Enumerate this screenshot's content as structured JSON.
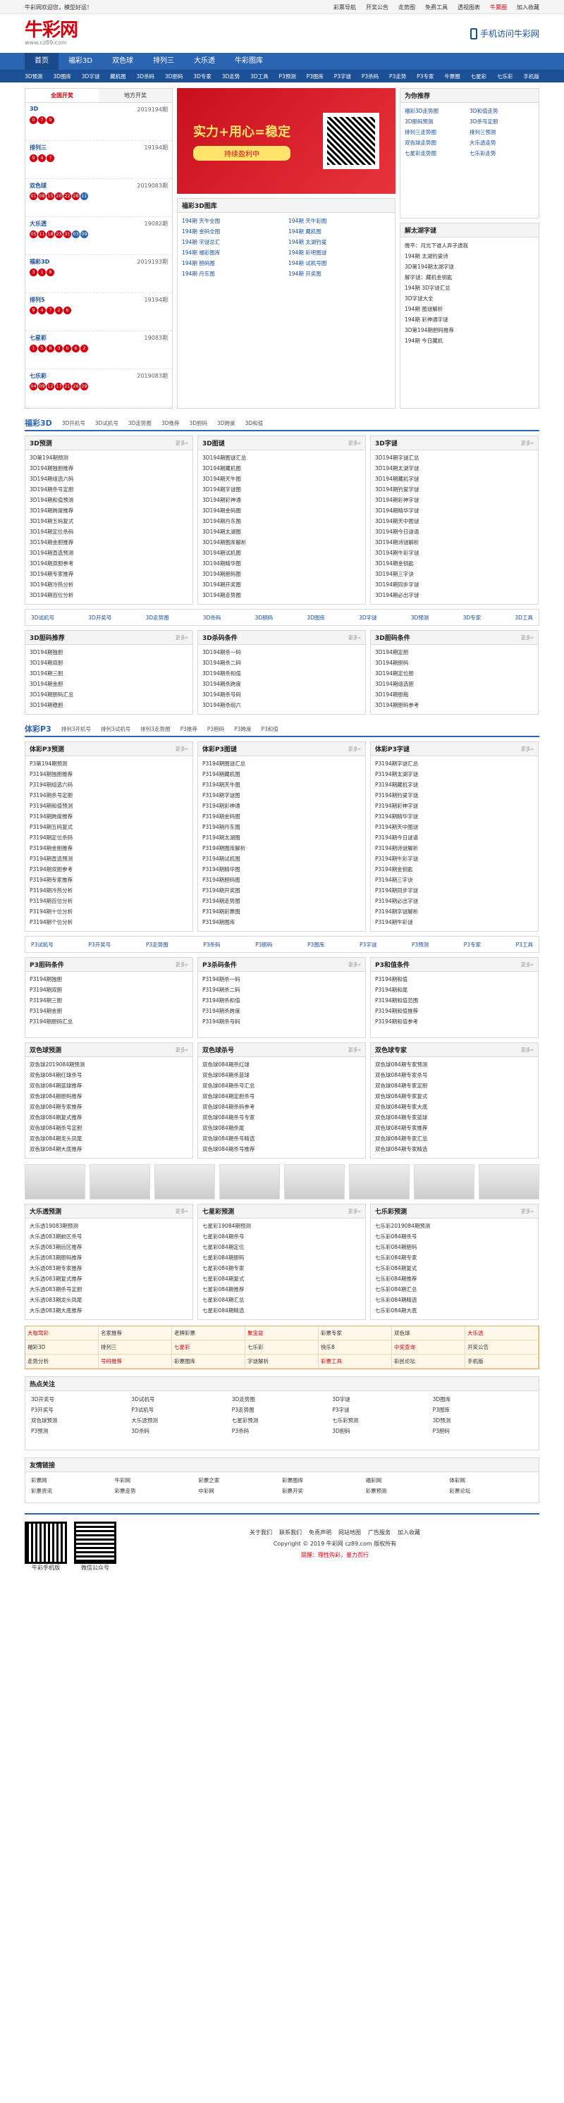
{
  "topbar": {
    "left": "牛彩网欢迎您，模型好运！",
    "links": [
      "彩票导航",
      "开奖公告",
      "走势图",
      "免费工具",
      "透视图表",
      "牛票圈",
      "加入收藏"
    ]
  },
  "header": {
    "logo": "牛彩网",
    "site": "www.cz89.com",
    "mobile": "手机访问牛彩网"
  },
  "nav": [
    "首页",
    "福彩3D",
    "双色球",
    "排列三",
    "大乐透",
    "牛彩图库"
  ],
  "subnav": [
    "3D预测",
    "3D图库",
    "3D字谜",
    "藏机图",
    "3D杀码",
    "3D胆码",
    "3D专家",
    "3D走势",
    "3D工具",
    "P3预测",
    "P3图库",
    "P3字谜",
    "P3杀码",
    "P3走势",
    "P3专家",
    "牛票圈",
    "七星彩",
    "七乐彩",
    "手机版"
  ],
  "kaijiang": {
    "tabs": [
      "全国开奖",
      "地方开奖"
    ],
    "items": [
      {
        "name": "3D",
        "issue": "2019194期",
        "nums": [
          "0",
          "7",
          "9"
        ]
      },
      {
        "name": "排列三",
        "issue": "19194期",
        "nums": [
          "9",
          "4",
          "7"
        ]
      },
      {
        "name": "双色球",
        "issue": "2019083期",
        "nums": [
          "01",
          "08",
          "15",
          "20",
          "22",
          "28",
          "11"
        ]
      },
      {
        "name": "大乐透",
        "issue": "19082期",
        "nums": [
          "05",
          "11",
          "18",
          "23",
          "31",
          "03",
          "09"
        ]
      },
      {
        "name": "福彩3D",
        "issue": "2019193期",
        "nums": [
          "3",
          "1",
          "8"
        ]
      },
      {
        "name": "排列5",
        "issue": "19194期",
        "nums": [
          "9",
          "4",
          "7",
          "2",
          "6"
        ]
      },
      {
        "name": "七星彩",
        "issue": "19083期",
        "nums": [
          "1",
          "5",
          "8",
          "3",
          "0",
          "6",
          "2"
        ]
      },
      {
        "name": "七乐彩",
        "issue": "2019083期",
        "nums": [
          "04",
          "09",
          "12",
          "17",
          "21",
          "26",
          "29"
        ]
      }
    ]
  },
  "banner": {
    "line1": "实力+用心=稳定",
    "line2": "持续盈利中"
  },
  "rank": {
    "title": "为你推荐",
    "items": [
      "福彩3D走势图",
      "3D和值走势",
      "3D胆码预测",
      "3D杀号定胆",
      "排列三走势图",
      "排列三预测",
      "双色球走势图",
      "大乐透走势",
      "七星彩走势图",
      "七乐彩走势"
    ]
  },
  "tuku": {
    "title": "福彩3D图库",
    "items": [
      "194期 天牛全图",
      "194期 天牛彩图",
      "194期 金码全图",
      "194期 藏机图",
      "194期 字谜总汇",
      "194期 太湖钓叟",
      "194期 福彩图库",
      "194期 彩吧图谜",
      "194期 胆码图",
      "194期 试机号图",
      "194期 丹东图",
      "194期 开奖图"
    ]
  },
  "zimi": {
    "title": "解太湖字谜",
    "items": [
      "晚平：月光下谁人弃子遗我",
      "194期 太湖钓叟诗",
      "3D第194期太湖字谜",
      "解字谜：藏机金钥匙",
      "194期 3D字谜汇总",
      "3D字谜大全",
      "194期 图谜解析",
      "194期 彩神通字谜",
      "3D第194期胆码推荐",
      "194期 今日藏机"
    ]
  },
  "sec1": {
    "title": "福彩3D",
    "tabs": [
      "3D开机号",
      "3D试机号",
      "3D走势图",
      "3D推荐",
      "3D胆码",
      "3D跨度",
      "3D和值"
    ],
    "cols": [
      {
        "title": "3D预测",
        "items": [
          "3D第194期预测",
          "3D194期独胆推荐",
          "3D194期组选六码",
          "3D194期杀号定胆",
          "3D194期和值预测",
          "3D194期跨度推荐",
          "3D194期五码复式",
          "3D194期定位杀码",
          "3D194期金胆推荐",
          "3D194期直选预测",
          "3D194期双胆参考",
          "3D194期专家推荐",
          "3D194期冷热分析",
          "3D194期百位分析"
        ]
      },
      {
        "title": "3D图谜",
        "items": [
          "3D194期图谜汇总",
          "3D194期藏机图",
          "3D194期天牛图",
          "3D194期字谜图",
          "3D194期彩神通",
          "3D194期金码图",
          "3D194期丹东图",
          "3D194期太湖图",
          "3D194期图库解析",
          "3D194期试机图",
          "3D194期精华图",
          "3D194期胆码图",
          "3D194期开奖图",
          "3D194期走势图"
        ]
      },
      {
        "title": "3D字谜",
        "items": [
          "3D194期字谜汇总",
          "3D194期太湖字谜",
          "3D194期藏机字谜",
          "3D194期钓叟字谜",
          "3D194期彩神字谜",
          "3D194期精华字谜",
          "3D194期天中图谜",
          "3D194期今日谜语",
          "3D194期诗谜解析",
          "3D194期牛彩字谜",
          "3D194期金钥匙",
          "3D194期三字诀",
          "3D194期同步字谜",
          "3D194期必出字谜"
        ]
      }
    ]
  },
  "kw1": [
    "3D试机号",
    "3D开奖号",
    "3D走势图",
    "3D杀码",
    "3D胆码",
    "3D图库",
    "3D字谜",
    "3D预测",
    "3D专家",
    "3D工具"
  ],
  "sec1b": [
    {
      "title": "3D胆码推荐",
      "items": [
        "3D194期独胆",
        "3D194期双胆",
        "3D194期三胆",
        "3D194期金胆",
        "3D194期胆码汇总",
        "3D194期稳胆"
      ]
    },
    {
      "title": "3D杀码条件",
      "items": [
        "3D194期杀一码",
        "3D194期杀二码",
        "3D194期杀和值",
        "3D194期杀跨度",
        "3D194期杀号码",
        "3D194期杀组六"
      ]
    },
    {
      "title": "3D胆码条件",
      "items": [
        "3D194期定胆",
        "3D194期胆码",
        "3D194期定位胆",
        "3D194期组选胆",
        "3D194期胆拖",
        "3D194期胆码参考"
      ]
    }
  ],
  "sec2": {
    "title": "体彩P3",
    "tabs": [
      "排列3开机号",
      "排列3试机号",
      "排列3走势图",
      "P3推荐",
      "P3胆码",
      "P3跨度",
      "P3和值"
    ],
    "cols": [
      {
        "title": "体彩P3预测",
        "items": [
          "P3第194期预测",
          "P3194期独胆推荐",
          "P3194期组选六码",
          "P3194期杀号定胆",
          "P3194期和值预测",
          "P3194期跨度推荐",
          "P3194期五码复式",
          "P3194期定位杀码",
          "P3194期金胆推荐",
          "P3194期直选预测",
          "P3194期双胆参考",
          "P3194期专家推荐",
          "P3194期冷热分析",
          "P3194期百位分析",
          "P3194期十位分析",
          "P3194期个位分析"
        ]
      },
      {
        "title": "体彩P3图谜",
        "items": [
          "P3194期图谜汇总",
          "P3194期藏机图",
          "P3194期天牛图",
          "P3194期字谜图",
          "P3194期彩神通",
          "P3194期金码图",
          "P3194期丹东图",
          "P3194期太湖图",
          "P3194期图库解析",
          "P3194期试机图",
          "P3194期精华图",
          "P3194期胆码图",
          "P3194期开奖图",
          "P3194期走势图",
          "P3194期彩票图",
          "P3194期图库"
        ]
      },
      {
        "title": "体彩P3字谜",
        "items": [
          "P3194期字谜汇总",
          "P3194期太湖字谜",
          "P3194期藏机字谜",
          "P3194期钓叟字谜",
          "P3194期彩神字谜",
          "P3194期精华字谜",
          "P3194期天中图谜",
          "P3194期今日谜语",
          "P3194期诗谜解析",
          "P3194期牛彩字谜",
          "P3194期金钥匙",
          "P3194期三字诀",
          "P3194期同步字谜",
          "P3194期必出字谜",
          "P3194期字谜解析",
          "P3194期牛彩谜"
        ]
      }
    ]
  },
  "kw2": [
    "P3试机号",
    "P3开奖号",
    "P3走势图",
    "P3杀码",
    "P3胆码",
    "P3图库",
    "P3字谜",
    "P3预测",
    "P3专家",
    "P3工具"
  ],
  "sec2b": [
    {
      "title": "P3胆码条件",
      "items": [
        "P3194期独胆",
        "P3194期双胆",
        "P3194期三胆",
        "P3194期金胆",
        "P3194期胆码汇总"
      ]
    },
    {
      "title": "P3杀码条件",
      "items": [
        "P3194期杀一码",
        "P3194期杀二码",
        "P3194期杀和值",
        "P3194期杀跨度",
        "P3194期杀号码"
      ]
    },
    {
      "title": "P3和值条件",
      "items": [
        "P3194期和值",
        "P3194期和尾",
        "P3194期和值范围",
        "P3194期和值推荐",
        "P3194期和值参考"
      ]
    }
  ],
  "sec3": [
    {
      "title": "双色球预测",
      "items": [
        "双色球2019084期预测",
        "双色球084期红球杀号",
        "双色球084期蓝球推荐",
        "双色球084期胆码推荐",
        "双色球084期专家推荐",
        "双色球084期复式推荐",
        "双色球084期杀号定胆",
        "双色球084期龙头凤尾",
        "双色球084期大底推荐"
      ]
    },
    {
      "title": "双色球杀号",
      "items": [
        "双色球084期杀红球",
        "双色球084期杀蓝球",
        "双色球084期杀号汇总",
        "双色球084期定胆杀号",
        "双色球084期杀码参考",
        "双色球084期杀号专家",
        "双色球084期杀尾",
        "双色球084期杀号精选",
        "双色球084期杀号推荐"
      ]
    },
    {
      "title": "双色球专家",
      "items": [
        "双色球084期专家预测",
        "双色球084期专家杀号",
        "双色球084期专家定胆",
        "双色球084期专家复式",
        "双色球084期专家大底",
        "双色球084期专家蓝球",
        "双色球084期专家推荐",
        "双色球084期专家汇总",
        "双色球084期专家精选"
      ]
    }
  ],
  "sec4": [
    {
      "title": "大乐透预测",
      "items": [
        "大乐透19083期预测",
        "大乐透083期前区杀号",
        "大乐透083期后区推荐",
        "大乐透083期胆码推荐",
        "大乐透083期专家推荐",
        "大乐透083期复式推荐",
        "大乐透083期杀号定胆",
        "大乐透083期龙头凤尾",
        "大乐透083期大底推荐"
      ]
    },
    {
      "title": "七星彩预测",
      "items": [
        "七星彩19084期预测",
        "七星彩084期杀号",
        "七星彩084期定位",
        "七星彩084期胆码",
        "七星彩084期专家",
        "七星彩084期复式",
        "七星彩084期推荐",
        "七星彩084期汇总",
        "七星彩084期精选"
      ]
    },
    {
      "title": "七乐彩预测",
      "items": [
        "七乐彩2019084期预测",
        "七乐彩084期杀号",
        "七乐彩084期胆码",
        "七乐彩084期专家",
        "七乐彩084期复式",
        "七乐彩084期推荐",
        "七乐彩084期汇总",
        "七乐彩084期精选",
        "七乐彩084期大底"
      ]
    }
  ],
  "ads": [
    "大咖驾彩",
    "名家推荐",
    "老牌彩票",
    "聚宝盆",
    "彩票专家",
    "双色球",
    "大乐透",
    "福彩3D",
    "排列三",
    "七星彩",
    "七乐彩",
    "快乐8",
    "中奖查询",
    "开奖公告",
    "走势分析",
    "号码推荐",
    "彩票图库",
    "字谜解析",
    "彩票工具",
    "彩民论坛",
    "手机版"
  ],
  "hot": {
    "title": "热点关注",
    "items": [
      "3D开奖号",
      "3D试机号",
      "3D走势图",
      "3D字谜",
      "3D图库",
      "P3开奖号",
      "P3试机号",
      "P3走势图",
      "P3字谜",
      "P3图库",
      "双色球预测",
      "大乐透预测",
      "七星彩预测",
      "七乐彩预测",
      "3D预测",
      "P3预测",
      "3D杀码",
      "P3杀码",
      "3D胆码",
      "P3胆码"
    ]
  },
  "friends": {
    "title": "友情链接",
    "items": [
      "彩票网",
      "牛彩网",
      "彩票之家",
      "彩票图库",
      "福彩网",
      "体彩网",
      "彩票资讯",
      "彩票走势",
      "中彩网",
      "彩票开奖",
      "彩票预测",
      "彩票论坛"
    ]
  },
  "footer": {
    "links": [
      "关于我们",
      "联系我们",
      "免责声明",
      "网站地图",
      "广告服务",
      "加入收藏"
    ],
    "copy": "Copyright © 2019 牛彩网 cz89.com 版权所有",
    "qr": [
      "牛彩手机版",
      "微信公众号"
    ],
    "note": "提醒：理性购彩，量力而行"
  }
}
